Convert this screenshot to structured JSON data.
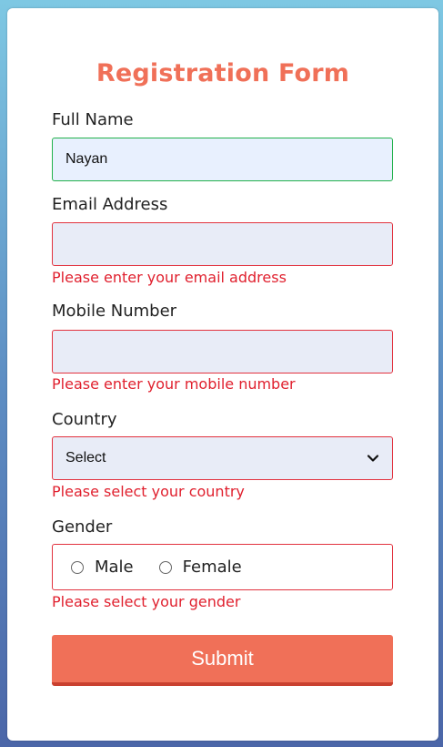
{
  "form": {
    "title": "Registration Form",
    "full_name": {
      "label": "Full Name",
      "value": "Nayan"
    },
    "email": {
      "label": "Email Address",
      "value": "",
      "error": "Please enter your email address"
    },
    "mobile": {
      "label": "Mobile Number",
      "value": "",
      "error": "Please enter your mobile number"
    },
    "country": {
      "label": "Country",
      "selected": "Select",
      "error": "Please select your country"
    },
    "gender": {
      "label": "Gender",
      "options": [
        "Male",
        "Female"
      ],
      "error": "Please select your gender"
    },
    "submit_label": "Submit"
  },
  "colors": {
    "accent": "#f07058",
    "error": "#e0202e",
    "valid": "#22b14c"
  },
  "icons": {
    "country_dropdown": "chevron-down-icon"
  }
}
